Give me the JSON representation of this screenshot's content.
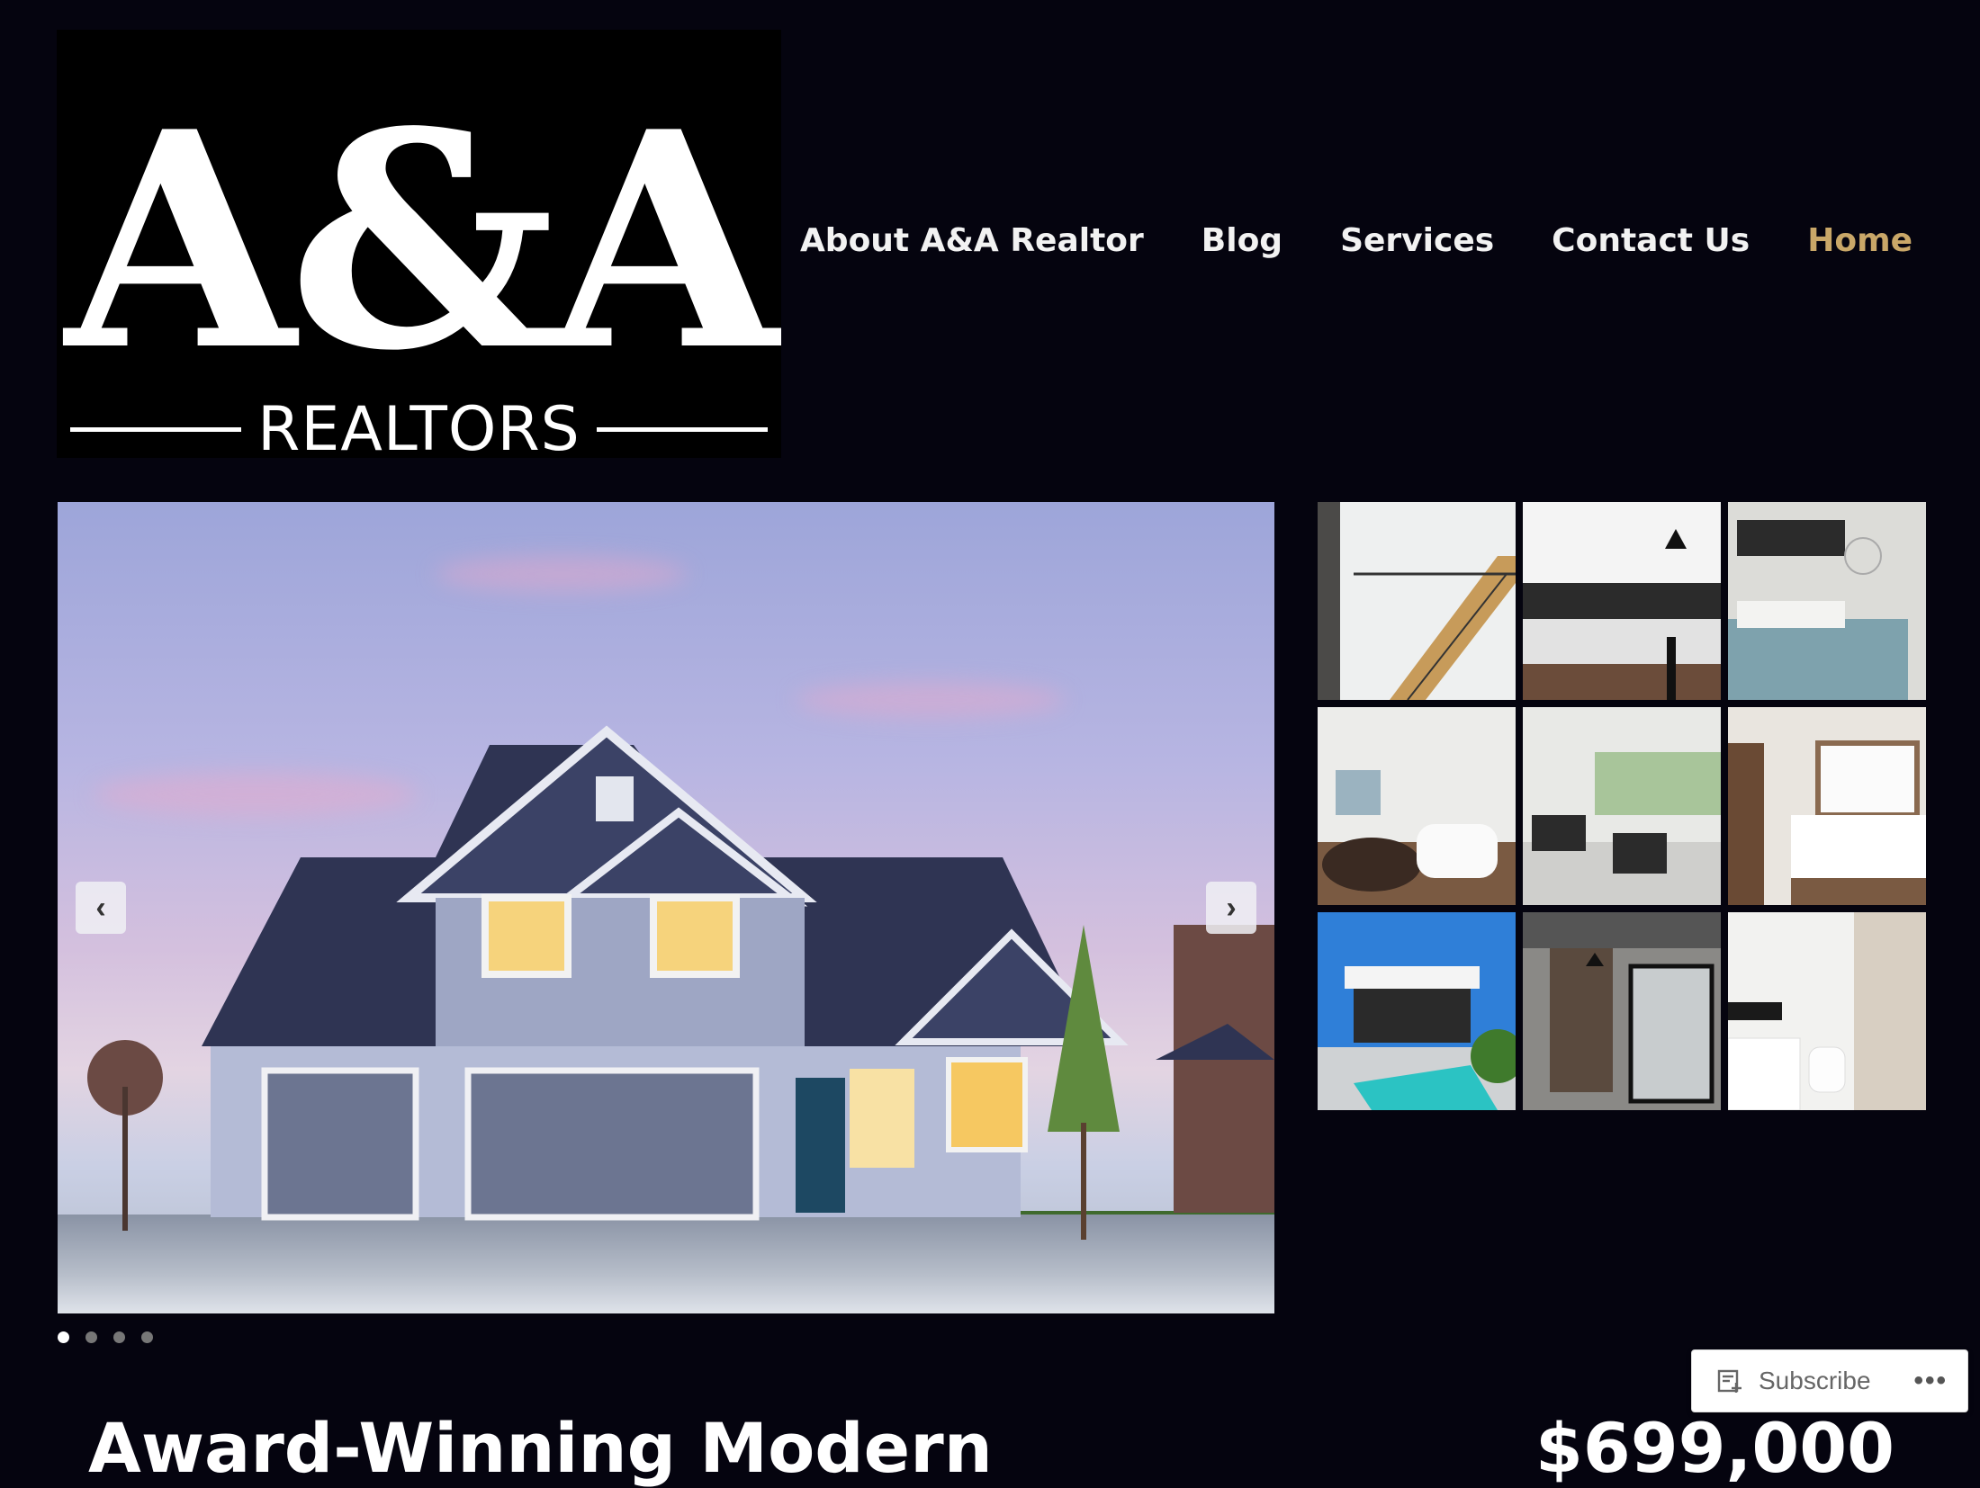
{
  "logo": {
    "mark": "A&A",
    "sub": "REALTORS"
  },
  "nav": [
    {
      "label": "About A&A Realtor"
    },
    {
      "label": "Blog"
    },
    {
      "label": "Services"
    },
    {
      "label": "Contact Us"
    },
    {
      "label": "Home",
      "current": true
    }
  ],
  "colors": {
    "background": "#05040f",
    "nav_active": "#c9a768",
    "nav_text": "#f2f2f2"
  },
  "slider": {
    "prev_icon": "chevron-left-icon",
    "next_icon": "chevron-right-icon",
    "slide_count": 4,
    "active_slide": 1
  },
  "gallery": {
    "tiles": [
      "staircase",
      "kitchen",
      "bedroom",
      "bathroom",
      "living-room",
      "bedroom-2",
      "pool-house",
      "office",
      "shower-room"
    ]
  },
  "listing": {
    "title": "Award-Winning Modern",
    "price": "$699,000"
  },
  "subscribe": {
    "label": "Subscribe",
    "more": "•••"
  }
}
